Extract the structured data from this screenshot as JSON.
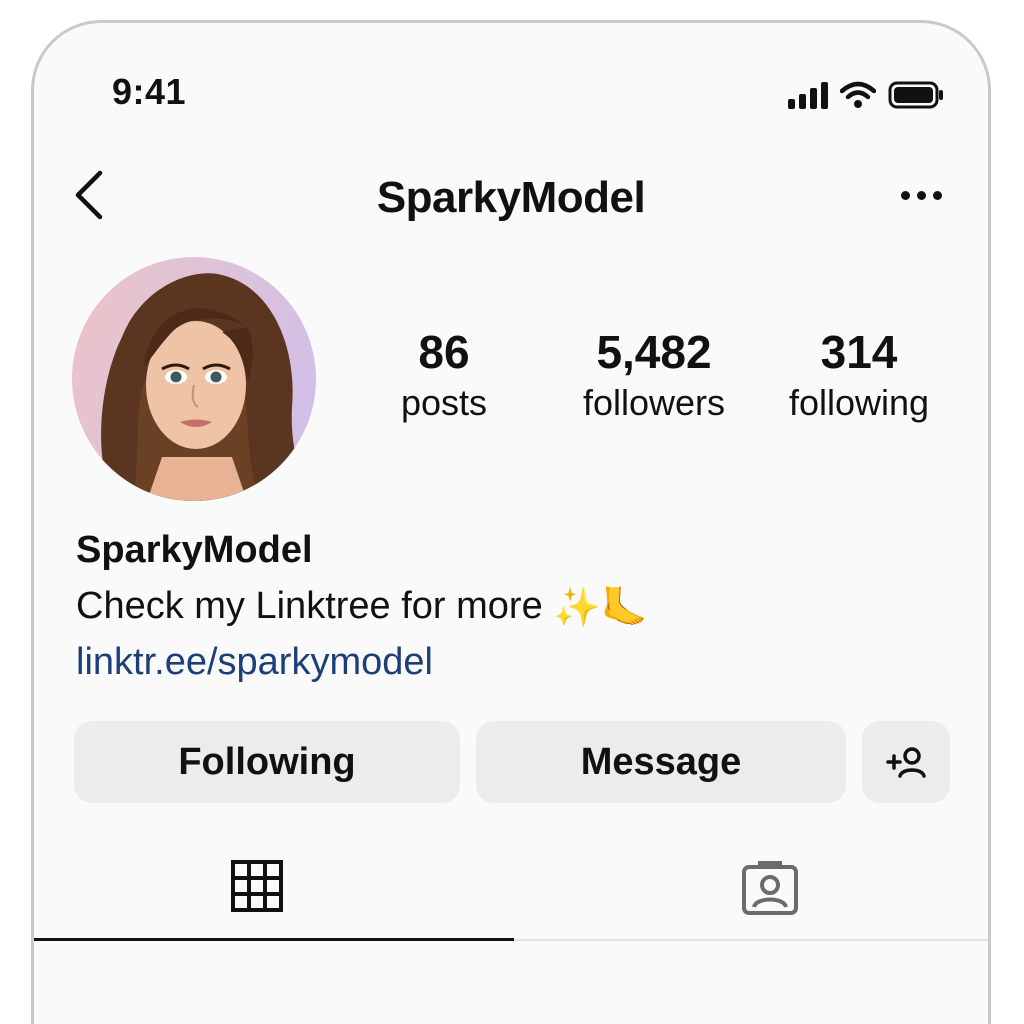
{
  "status_bar": {
    "time": "9:41"
  },
  "header": {
    "title": "SparkyModel"
  },
  "profile": {
    "stats": [
      {
        "value": "86",
        "label": "posts"
      },
      {
        "value": "5,482",
        "label": "followers"
      },
      {
        "value": "314",
        "label": "following"
      }
    ],
    "display_name": "SparkyModel",
    "bio": "Check my Linktree for more",
    "bio_emoji": "✨🦶",
    "link": "linktr.ee/sparkymodel"
  },
  "actions": {
    "following_label": "Following",
    "message_label": "Message",
    "add_user_icon": "add-person-icon"
  },
  "tabs": [
    {
      "icon": "grid-icon",
      "active": true
    },
    {
      "icon": "tagged-icon",
      "active": false
    }
  ],
  "colors": {
    "link": "#1d3f79",
    "button_bg": "#ececec",
    "background": "#fafafa"
  }
}
